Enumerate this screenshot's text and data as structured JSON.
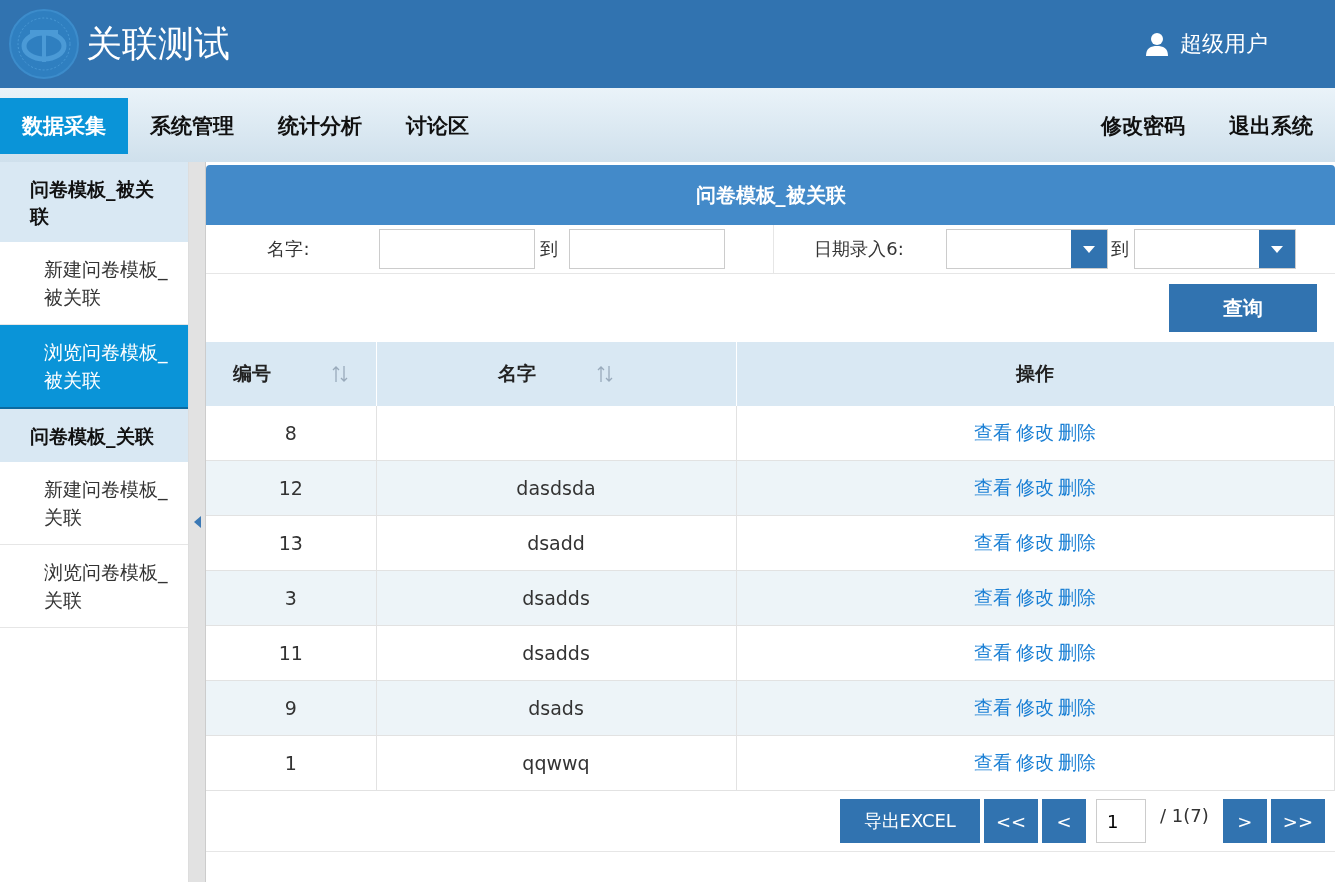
{
  "header": {
    "title": "关联测试",
    "user": "超级用户"
  },
  "nav": {
    "items": [
      {
        "label": "数据采集",
        "selected": true
      },
      {
        "label": "系统管理",
        "selected": false
      },
      {
        "label": "统计分析",
        "selected": false
      },
      {
        "label": "讨论区",
        "selected": false
      }
    ],
    "right": [
      "修改密码",
      "退出系统"
    ]
  },
  "sidebar": {
    "groups": [
      {
        "title": "问卷模板_被关联",
        "items": [
          {
            "label": "新建问卷模板_被关联",
            "selected": false
          },
          {
            "label": "浏览问卷模板_被关联",
            "selected": true
          }
        ]
      },
      {
        "title": "问卷模板_关联",
        "items": [
          {
            "label": "新建问卷模板_关联",
            "selected": false
          },
          {
            "label": "浏览问卷模板_关联",
            "selected": false
          }
        ]
      }
    ]
  },
  "panel": {
    "title": "问卷模板_被关联",
    "filters": {
      "name_label": "名字:",
      "to_1": "到",
      "date_label": "日期录入6:",
      "to_2": "到"
    },
    "query_button": "查询",
    "table": {
      "columns": [
        {
          "label": "编号",
          "sortable": true
        },
        {
          "label": "名字",
          "sortable": true
        },
        {
          "label": "操作",
          "sortable": false
        }
      ],
      "rows": [
        {
          "id": "8",
          "name": "",
          "actions": [
            "查看",
            "修改",
            "删除"
          ]
        },
        {
          "id": "12",
          "name": "dasdsda",
          "actions": [
            "查看",
            "修改",
            "删除"
          ]
        },
        {
          "id": "13",
          "name": "dsadd",
          "actions": [
            "查看",
            "修改",
            "删除"
          ]
        },
        {
          "id": "3",
          "name": "dsadds",
          "actions": [
            "查看",
            "修改",
            "删除"
          ]
        },
        {
          "id": "11",
          "name": "dsadds",
          "actions": [
            "查看",
            "修改",
            "删除"
          ]
        },
        {
          "id": "9",
          "name": "dsads",
          "actions": [
            "查看",
            "修改",
            "删除"
          ]
        },
        {
          "id": "1",
          "name": "qqwwq",
          "actions": [
            "查看",
            "修改",
            "删除"
          ]
        }
      ]
    },
    "pagination": {
      "export": "导出EXCEL",
      "first": "<<",
      "prev": "<",
      "page": "1",
      "total": "/ 1(7)",
      "next": ">",
      "last": ">>"
    }
  }
}
